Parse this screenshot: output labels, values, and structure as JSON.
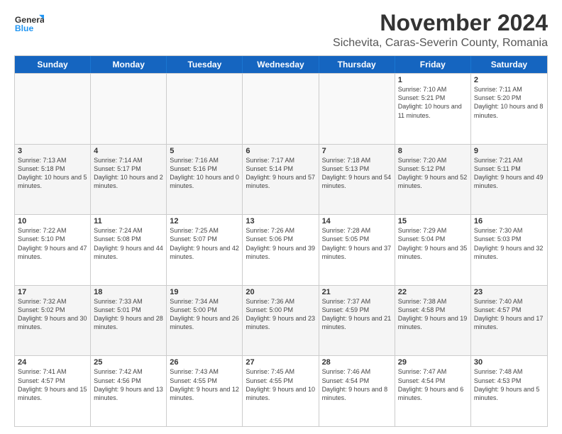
{
  "header": {
    "logo_general": "General",
    "logo_blue": "Blue",
    "month": "November 2024",
    "location": "Sichevita, Caras-Severin County, Romania"
  },
  "days_of_week": [
    "Sunday",
    "Monday",
    "Tuesday",
    "Wednesday",
    "Thursday",
    "Friday",
    "Saturday"
  ],
  "weeks": [
    [
      {
        "day": "",
        "text": ""
      },
      {
        "day": "",
        "text": ""
      },
      {
        "day": "",
        "text": ""
      },
      {
        "day": "",
        "text": ""
      },
      {
        "day": "",
        "text": ""
      },
      {
        "day": "1",
        "text": "Sunrise: 7:10 AM\nSunset: 5:21 PM\nDaylight: 10 hours and 11 minutes."
      },
      {
        "day": "2",
        "text": "Sunrise: 7:11 AM\nSunset: 5:20 PM\nDaylight: 10 hours and 8 minutes."
      }
    ],
    [
      {
        "day": "3",
        "text": "Sunrise: 7:13 AM\nSunset: 5:18 PM\nDaylight: 10 hours and 5 minutes."
      },
      {
        "day": "4",
        "text": "Sunrise: 7:14 AM\nSunset: 5:17 PM\nDaylight: 10 hours and 2 minutes."
      },
      {
        "day": "5",
        "text": "Sunrise: 7:16 AM\nSunset: 5:16 PM\nDaylight: 10 hours and 0 minutes."
      },
      {
        "day": "6",
        "text": "Sunrise: 7:17 AM\nSunset: 5:14 PM\nDaylight: 9 hours and 57 minutes."
      },
      {
        "day": "7",
        "text": "Sunrise: 7:18 AM\nSunset: 5:13 PM\nDaylight: 9 hours and 54 minutes."
      },
      {
        "day": "8",
        "text": "Sunrise: 7:20 AM\nSunset: 5:12 PM\nDaylight: 9 hours and 52 minutes."
      },
      {
        "day": "9",
        "text": "Sunrise: 7:21 AM\nSunset: 5:11 PM\nDaylight: 9 hours and 49 minutes."
      }
    ],
    [
      {
        "day": "10",
        "text": "Sunrise: 7:22 AM\nSunset: 5:10 PM\nDaylight: 9 hours and 47 minutes."
      },
      {
        "day": "11",
        "text": "Sunrise: 7:24 AM\nSunset: 5:08 PM\nDaylight: 9 hours and 44 minutes."
      },
      {
        "day": "12",
        "text": "Sunrise: 7:25 AM\nSunset: 5:07 PM\nDaylight: 9 hours and 42 minutes."
      },
      {
        "day": "13",
        "text": "Sunrise: 7:26 AM\nSunset: 5:06 PM\nDaylight: 9 hours and 39 minutes."
      },
      {
        "day": "14",
        "text": "Sunrise: 7:28 AM\nSunset: 5:05 PM\nDaylight: 9 hours and 37 minutes."
      },
      {
        "day": "15",
        "text": "Sunrise: 7:29 AM\nSunset: 5:04 PM\nDaylight: 9 hours and 35 minutes."
      },
      {
        "day": "16",
        "text": "Sunrise: 7:30 AM\nSunset: 5:03 PM\nDaylight: 9 hours and 32 minutes."
      }
    ],
    [
      {
        "day": "17",
        "text": "Sunrise: 7:32 AM\nSunset: 5:02 PM\nDaylight: 9 hours and 30 minutes."
      },
      {
        "day": "18",
        "text": "Sunrise: 7:33 AM\nSunset: 5:01 PM\nDaylight: 9 hours and 28 minutes."
      },
      {
        "day": "19",
        "text": "Sunrise: 7:34 AM\nSunset: 5:00 PM\nDaylight: 9 hours and 26 minutes."
      },
      {
        "day": "20",
        "text": "Sunrise: 7:36 AM\nSunset: 5:00 PM\nDaylight: 9 hours and 23 minutes."
      },
      {
        "day": "21",
        "text": "Sunrise: 7:37 AM\nSunset: 4:59 PM\nDaylight: 9 hours and 21 minutes."
      },
      {
        "day": "22",
        "text": "Sunrise: 7:38 AM\nSunset: 4:58 PM\nDaylight: 9 hours and 19 minutes."
      },
      {
        "day": "23",
        "text": "Sunrise: 7:40 AM\nSunset: 4:57 PM\nDaylight: 9 hours and 17 minutes."
      }
    ],
    [
      {
        "day": "24",
        "text": "Sunrise: 7:41 AM\nSunset: 4:57 PM\nDaylight: 9 hours and 15 minutes."
      },
      {
        "day": "25",
        "text": "Sunrise: 7:42 AM\nSunset: 4:56 PM\nDaylight: 9 hours and 13 minutes."
      },
      {
        "day": "26",
        "text": "Sunrise: 7:43 AM\nSunset: 4:55 PM\nDaylight: 9 hours and 12 minutes."
      },
      {
        "day": "27",
        "text": "Sunrise: 7:45 AM\nSunset: 4:55 PM\nDaylight: 9 hours and 10 minutes."
      },
      {
        "day": "28",
        "text": "Sunrise: 7:46 AM\nSunset: 4:54 PM\nDaylight: 9 hours and 8 minutes."
      },
      {
        "day": "29",
        "text": "Sunrise: 7:47 AM\nSunset: 4:54 PM\nDaylight: 9 hours and 6 minutes."
      },
      {
        "day": "30",
        "text": "Sunrise: 7:48 AM\nSunset: 4:53 PM\nDaylight: 9 hours and 5 minutes."
      }
    ]
  ]
}
